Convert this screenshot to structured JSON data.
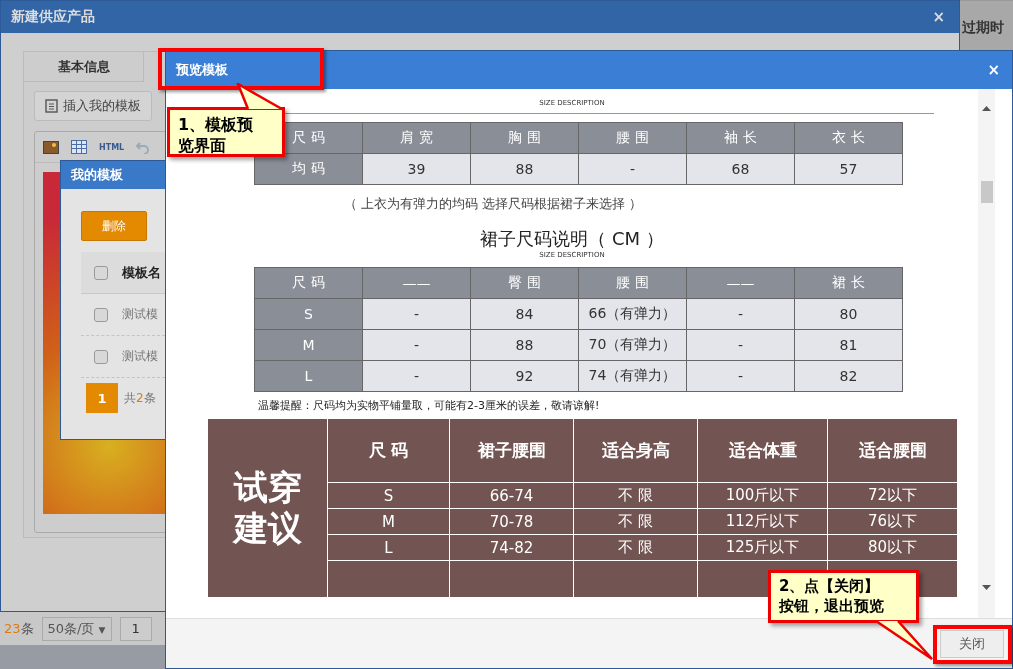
{
  "background_page": {
    "column_header": "过期时",
    "pager": {
      "total_count": "23",
      "total_suffix": "条",
      "page_size": "50条/页",
      "page_size_caret": "▼",
      "page": "1"
    }
  },
  "product_dialog": {
    "title": "新建供应产品",
    "close": "×",
    "tab": "基本信息",
    "insert_button": "插入我的模板",
    "toolbar_html": "HTML"
  },
  "template_dialog": {
    "title": "我的模板",
    "delete_button": "删除",
    "header": "模板名",
    "header_checked": false,
    "rows": [
      {
        "name": "测试模",
        "checked": false
      },
      {
        "name": "测试模",
        "checked": false
      }
    ],
    "pager": {
      "page": "1",
      "total_prefix": "共",
      "total_count": "2",
      "total_suffix": "条"
    }
  },
  "preview_dialog": {
    "title": "预览模板",
    "close": "×",
    "close_button": "关闭",
    "top_subtitle": "SIZE DESCRIPTION",
    "top_table": {
      "columns": [
        "尺 码",
        "肩 宽",
        "胸 围",
        "腰 围",
        "袖 长",
        "衣 长"
      ],
      "rows": [
        [
          "均 码",
          "39",
          "88",
          "-",
          "68",
          "57"
        ]
      ]
    },
    "top_note": "（ 上衣为有弹力的均码 选择尺码根据裙子来选择 ）",
    "skirt_heading": "裙子尺码说明（ CM ）",
    "skirt_subtitle": "SIZE DESCRIPTION",
    "skirt_table": {
      "columns": [
        "尺 码",
        "——",
        "臀 围",
        "腰 围",
        "——",
        "裙 长"
      ],
      "rows": [
        [
          "S",
          "-",
          "84",
          "66（有弹力）",
          "-",
          "80"
        ],
        [
          "M",
          "-",
          "88",
          "70（有弹力）",
          "-",
          "81"
        ],
        [
          "L",
          "-",
          "92",
          "74（有弹力）",
          "-",
          "82"
        ]
      ]
    },
    "reminder": "温馨提醒：尺码均为实物平铺量取，可能有2-3厘米的误差，敬请谅解!",
    "fit_table": {
      "side_label": "试穿建议",
      "columns": [
        "尺 码",
        "裙子腰围",
        "适合身高",
        "适合体重",
        "适合腰围"
      ],
      "rows": [
        [
          "S",
          "66-74",
          "不 限",
          "100斤以下",
          "72以下"
        ],
        [
          "M",
          "70-78",
          "不 限",
          "112斤以下",
          "76以下"
        ],
        [
          "L",
          "74-82",
          "不 限",
          "125斤以下",
          "80以下"
        ]
      ]
    }
  },
  "callouts": [
    {
      "kind": "top",
      "lines": [
        "1、模板预",
        "览界面"
      ]
    },
    {
      "kind": "bottom",
      "lines": [
        "2、点【关闭】",
        "按钮，退出预览"
      ]
    }
  ]
}
